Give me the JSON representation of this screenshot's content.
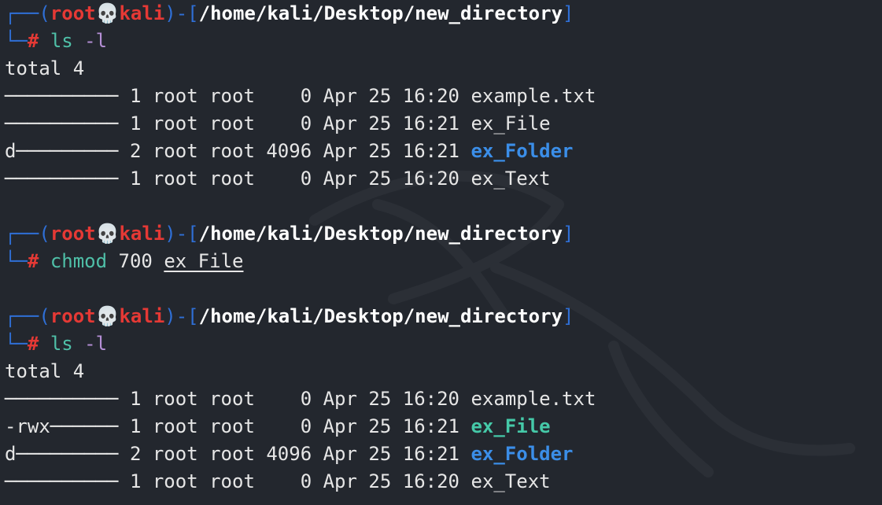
{
  "prompt": {
    "user": "root",
    "skull": "💀",
    "host": "kali",
    "path": "/home/kali/Desktop/new_directory",
    "hash": "#"
  },
  "blocks": [
    {
      "command": {
        "name": "ls",
        "args": "-l",
        "arg_style": "flag"
      },
      "output": [
        {
          "type": "total",
          "text": "total 4"
        },
        {
          "perms": "──────────",
          "links": "1",
          "owner": "root",
          "group": "root",
          "size": "   0",
          "date": "Apr 25 16:20",
          "name": "example.txt",
          "kind": "file"
        },
        {
          "perms": "──────────",
          "links": "1",
          "owner": "root",
          "group": "root",
          "size": "   0",
          "date": "Apr 25 16:21",
          "name": "ex_File",
          "kind": "file"
        },
        {
          "perms": "d─────────",
          "links": "2",
          "owner": "root",
          "group": "root",
          "size": "4096",
          "date": "Apr 25 16:21",
          "name": "ex_Folder",
          "kind": "dir"
        },
        {
          "perms": "──────────",
          "links": "1",
          "owner": "root",
          "group": "root",
          "size": "   0",
          "date": "Apr 25 16:20",
          "name": "ex_Text",
          "kind": "file"
        }
      ]
    },
    {
      "command": {
        "name": "chmod",
        "args": "700",
        "target": "ex_File",
        "arg_style": "plain"
      },
      "output": []
    },
    {
      "command": {
        "name": "ls",
        "args": "-l",
        "arg_style": "flag"
      },
      "output": [
        {
          "type": "total",
          "text": "total 4"
        },
        {
          "perms": "──────────",
          "links": "1",
          "owner": "root",
          "group": "root",
          "size": "   0",
          "date": "Apr 25 16:20",
          "name": "example.txt",
          "kind": "file"
        },
        {
          "perms": "-rwx──────",
          "links": "1",
          "owner": "root",
          "group": "root",
          "size": "   0",
          "date": "Apr 25 16:21",
          "name": "ex_File",
          "kind": "exec"
        },
        {
          "perms": "d─────────",
          "links": "2",
          "owner": "root",
          "group": "root",
          "size": "4096",
          "date": "Apr 25 16:21",
          "name": "ex_Folder",
          "kind": "dir"
        },
        {
          "perms": "──────────",
          "links": "1",
          "owner": "root",
          "group": "root",
          "size": "   0",
          "date": "Apr 25 16:20",
          "name": "ex_Text",
          "kind": "file"
        }
      ]
    }
  ],
  "colors": {
    "background": "#23272e",
    "prompt_box": "#2f6fd6",
    "user_host": "#e53935",
    "command": "#4fc0a8",
    "flag": "#b58fd6",
    "directory": "#3b8ee8",
    "executable": "#45c9a8"
  },
  "watermark_icon": "kali-dragon-icon"
}
